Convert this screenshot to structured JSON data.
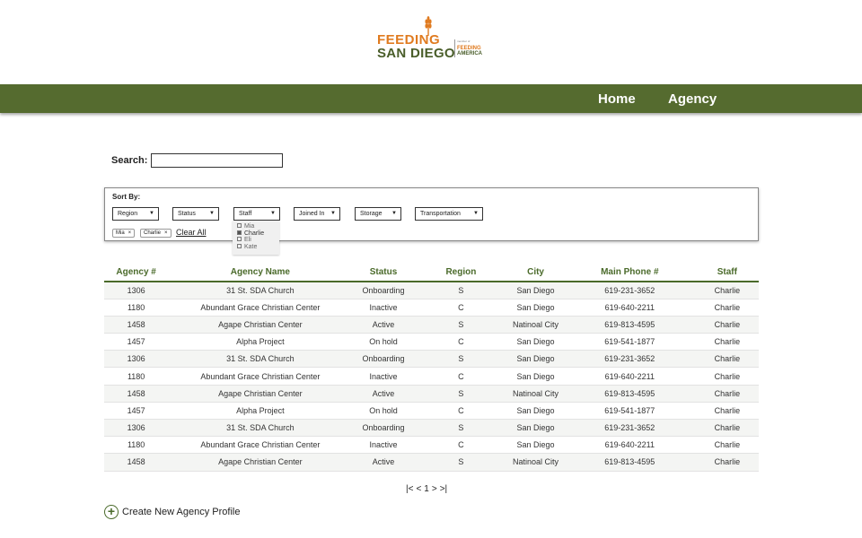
{
  "logo": {
    "line1": "FEEDING",
    "line2": "SAN DIEGO",
    "member_text": "member of",
    "partner_line1": "FEEDING",
    "partner_line2": "AMERICA",
    "colors": {
      "orange": "#e07b20",
      "green": "#4a5e2a"
    }
  },
  "nav": {
    "home": "Home",
    "agency": "Agency",
    "bar_color": "#556b2f"
  },
  "search": {
    "label": "Search:",
    "value": ""
  },
  "sort": {
    "label": "Sort By:",
    "dropdowns": [
      "Region",
      "Status",
      "Staff",
      "Joined In",
      "Storage",
      "Transportation"
    ],
    "chips": [
      "Mia",
      "Charlie"
    ],
    "clear_all": "Clear All"
  },
  "staff_menu": {
    "options": [
      {
        "label": "Mia",
        "checked": false
      },
      {
        "label": "Charlie",
        "checked": true
      },
      {
        "label": "Eli",
        "checked": false
      },
      {
        "label": "Kate",
        "checked": false
      }
    ]
  },
  "table": {
    "headers": [
      "Agency #",
      "Agency Name",
      "Status",
      "Region",
      "City",
      "Main Phone #",
      "Staff"
    ],
    "rows": [
      [
        "1306",
        "31 St. SDA Church",
        "Onboarding",
        "S",
        "San Diego",
        "619-231-3652",
        "Charlie"
      ],
      [
        "1180",
        "Abundant Grace Christian Center",
        "Inactive",
        "C",
        "San Diego",
        "619-640-2211",
        "Charlie"
      ],
      [
        "1458",
        "Agape Christian Center",
        "Active",
        "S",
        "Natinoal City",
        "619-813-4595",
        "Charlie"
      ],
      [
        "1457",
        "Alpha Project",
        "On hold",
        "C",
        "San Diego",
        "619-541-1877",
        "Charlie"
      ],
      [
        "1306",
        "31 St. SDA Church",
        "Onboarding",
        "S",
        "San Diego",
        "619-231-3652",
        "Charlie"
      ],
      [
        "1180",
        "Abundant Grace Christian Center",
        "Inactive",
        "C",
        "San Diego",
        "619-640-2211",
        "Charlie"
      ],
      [
        "1458",
        "Agape Christian Center",
        "Active",
        "S",
        "Natinoal City",
        "619-813-4595",
        "Charlie"
      ],
      [
        "1457",
        "Alpha Project",
        "On hold",
        "C",
        "San Diego",
        "619-541-1877",
        "Charlie"
      ],
      [
        "1306",
        "31 St. SDA Church",
        "Onboarding",
        "S",
        "San Diego",
        "619-231-3652",
        "Charlie"
      ],
      [
        "1180",
        "Abundant Grace Christian Center",
        "Inactive",
        "C",
        "San Diego",
        "619-640-2211",
        "Charlie"
      ],
      [
        "1458",
        "Agape Christian Center",
        "Active",
        "S",
        "Natinoal City",
        "619-813-4595",
        "Charlie"
      ]
    ]
  },
  "pager": {
    "first": "|<",
    "prev": "<",
    "page": "1",
    "next": ">",
    "last": ">|"
  },
  "create": {
    "icon": "+",
    "label": "Create New Agency Profile"
  }
}
